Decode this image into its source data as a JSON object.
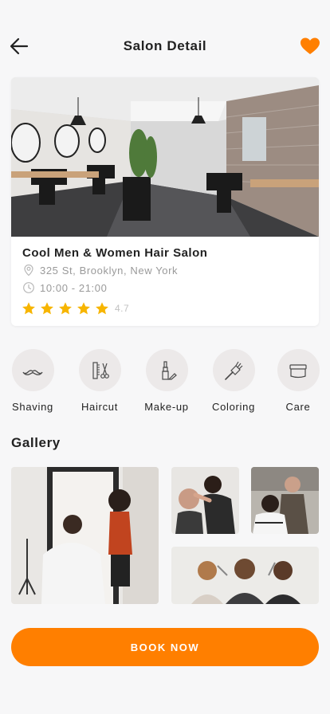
{
  "header": {
    "title": "Salon Detail",
    "back_icon": "arrow-left-icon",
    "favorite_icon": "heart-icon"
  },
  "colors": {
    "accent": "#ff7f00",
    "star": "#f7b500",
    "muted_text": "#9a9a9a",
    "icon_circle": "#ece9e9"
  },
  "salon": {
    "name": "Cool Men & Women Hair Salon",
    "address": "325 St, Brooklyn, New York",
    "hours": "10:00 - 21:00",
    "rating_value": "4.7",
    "stars": 5
  },
  "services": [
    {
      "label": "Shaving",
      "icon": "mustache-icon"
    },
    {
      "label": "Haircut",
      "icon": "comb-scissors-icon"
    },
    {
      "label": "Make-up",
      "icon": "lipstick-icon"
    },
    {
      "label": "Coloring",
      "icon": "brush-icon"
    },
    {
      "label": "Care",
      "icon": "cream-jar-icon"
    }
  ],
  "gallery": {
    "title": "Gallery"
  },
  "cta": {
    "label": "BOOK NOW"
  }
}
